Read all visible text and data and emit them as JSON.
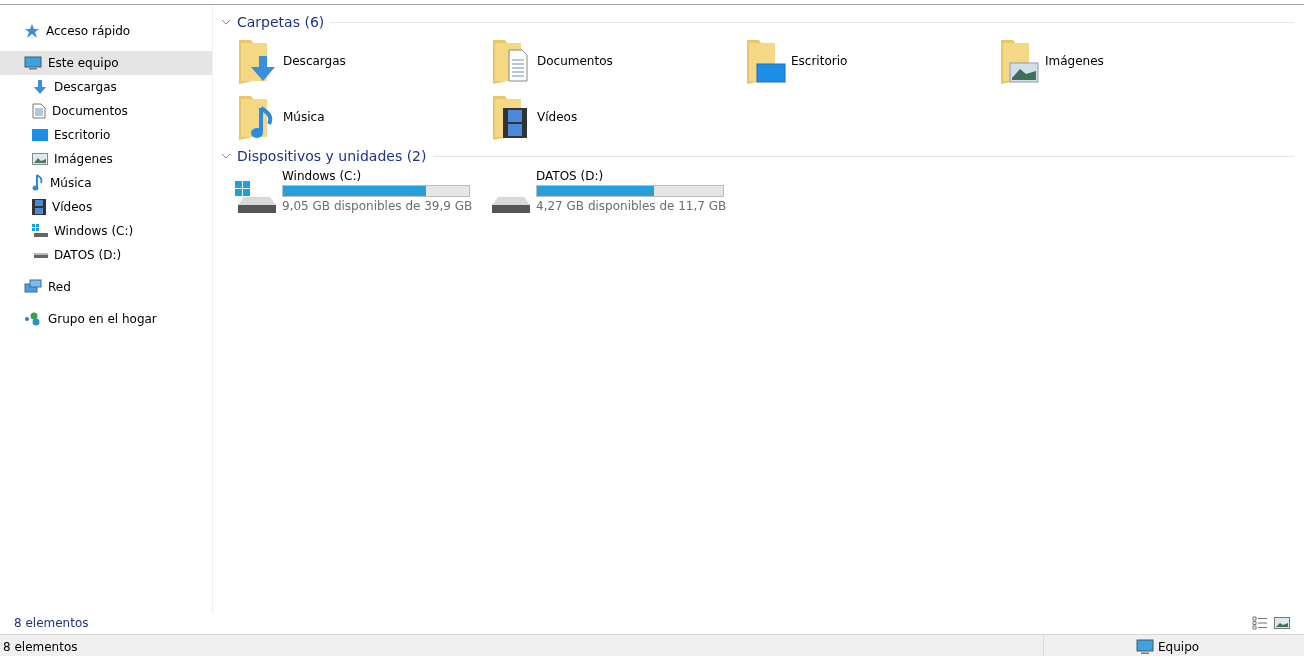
{
  "sidebar": {
    "items": [
      {
        "label": "Acceso rápido",
        "kind": "quick",
        "selected": false
      },
      {
        "label": "Este equipo",
        "kind": "pc",
        "selected": true,
        "children": [
          {
            "label": "Descargas",
            "kind": "downloads",
            "selected": false
          },
          {
            "label": "Documentos",
            "kind": "documents",
            "selected": false
          },
          {
            "label": "Escritorio",
            "kind": "desktop",
            "selected": false
          },
          {
            "label": "Imágenes",
            "kind": "pictures",
            "selected": false
          },
          {
            "label": "Música",
            "kind": "music",
            "selected": false
          },
          {
            "label": "Vídeos",
            "kind": "videos",
            "selected": false
          },
          {
            "label": "Windows (C:)",
            "kind": "windrive",
            "selected": false
          },
          {
            "label": "DATOS (D:)",
            "kind": "drive",
            "selected": false
          }
        ]
      },
      {
        "label": "Red",
        "kind": "network",
        "selected": false
      },
      {
        "label": "Grupo en el hogar",
        "kind": "homegroup",
        "selected": false
      }
    ]
  },
  "folders": {
    "title": "Carpetas (6)",
    "expanded": true,
    "items": [
      {
        "label": "Descargas",
        "kind": "downloads"
      },
      {
        "label": "Documentos",
        "kind": "documents"
      },
      {
        "label": "Escritorio",
        "kind": "desktop"
      },
      {
        "label": "Imágenes",
        "kind": "pictures"
      },
      {
        "label": "Música",
        "kind": "music"
      },
      {
        "label": "Vídeos",
        "kind": "videos"
      }
    ]
  },
  "devices": {
    "title": "Dispositivos y unidades (2)",
    "expanded": true,
    "items": [
      {
        "label": "Windows (C:)",
        "kind": "windrive",
        "level": 0.77,
        "free": "9,05 GB disponibles de 39,9 GB"
      },
      {
        "label": "DATOS (D:)",
        "kind": "drive",
        "level": 0.63,
        "free": "4,27 GB disponibles de 11,7 GB"
      }
    ]
  },
  "status_bar": {
    "count": "8 elementos"
  },
  "outer_status_bar": {
    "count": "8 elementos",
    "location": "Equipo"
  }
}
